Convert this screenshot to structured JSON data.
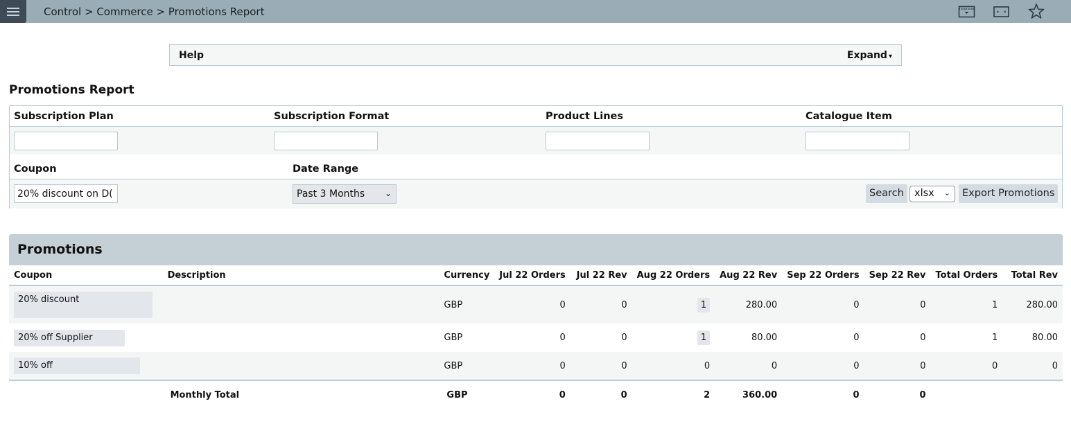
{
  "topbar": {
    "breadcrumb": "Control > Commerce > Promotions Report",
    "icons": [
      "menu-icon",
      "calendar-dropdown-icon",
      "expand-width-icon",
      "star-icon"
    ]
  },
  "help": {
    "label": "Help",
    "expand_label": "Expand",
    "expand_caret": "▾"
  },
  "page_title": "Promotions Report",
  "filters": {
    "subscription_plan": {
      "label": "Subscription Plan",
      "value": ""
    },
    "subscription_format": {
      "label": "Subscription Format",
      "value": ""
    },
    "product_lines": {
      "label": "Product Lines",
      "value": ""
    },
    "catalogue_item": {
      "label": "Catalogue Item",
      "value": ""
    },
    "coupon": {
      "label": "Coupon",
      "value": "20% discount on D("
    },
    "date_range": {
      "label": "Date Range",
      "selected": "Past 3 Months"
    },
    "search_label": "Search",
    "export_format": "xlsx",
    "export_label": "Export Promotions"
  },
  "promotions": {
    "title": "Promotions",
    "columns": [
      "Coupon",
      "Description",
      "Currency",
      "Jul 22 Orders",
      "Jul 22 Rev",
      "Aug 22 Orders",
      "Aug 22 Rev",
      "Sep 22 Orders",
      "Sep 22 Rev",
      "Total Orders",
      "Total Rev"
    ],
    "rows": [
      {
        "coupon": "20% discount",
        "description": "",
        "currency": "GBP",
        "jul_orders": "0",
        "jul_rev": "0",
        "aug_orders": "1",
        "aug_rev": "280.00",
        "sep_orders": "0",
        "sep_rev": "0",
        "total_orders": "1",
        "total_rev": "280.00"
      },
      {
        "coupon": "20% off Supplier",
        "description": "",
        "currency": "GBP",
        "jul_orders": "0",
        "jul_rev": "0",
        "aug_orders": "1",
        "aug_rev": "80.00",
        "sep_orders": "0",
        "sep_rev": "0",
        "total_orders": "1",
        "total_rev": "80.00"
      },
      {
        "coupon": "10% off",
        "description": "",
        "currency": "GBP",
        "jul_orders": "0",
        "jul_rev": "0",
        "aug_orders": "0",
        "aug_rev": "0",
        "sep_orders": "0",
        "sep_rev": "0",
        "total_orders": "0",
        "total_rev": "0"
      }
    ],
    "total": {
      "label": "Monthly Total",
      "currency": "GBP",
      "jul_orders": "0",
      "jul_rev": "0",
      "aug_orders": "2",
      "aug_rev": "360.00",
      "sep_orders": "0",
      "sep_rev": "0"
    }
  }
}
